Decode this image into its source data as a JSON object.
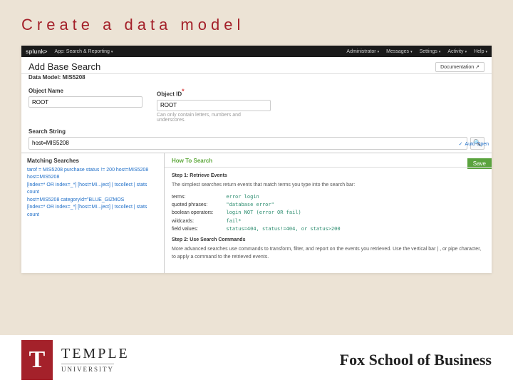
{
  "slide": {
    "title": "Create a data model"
  },
  "topbar": {
    "logo": "splunk>",
    "app_label": "App: Search & Reporting",
    "right": [
      "Administrator",
      "Messages",
      "Settings",
      "Activity",
      "Help"
    ]
  },
  "page": {
    "heading": "Add Base Search",
    "doc_link": "Documentation",
    "data_model_label": "Data Model:",
    "data_model_value": "MIS5208"
  },
  "fields": {
    "object_name_label": "Object Name",
    "object_name_value": "ROOT",
    "object_id_label": "Object ID",
    "object_id_value": "ROOT",
    "object_id_hint": "Can only contain letters, numbers and underscores."
  },
  "search": {
    "label": "Search String",
    "value": "host=MIS5208",
    "auto_open": "Auto Open",
    "save_label": "Save"
  },
  "matching": {
    "heading": "Matching Searches",
    "lines": [
      "tarof = MIS5208 purchase status != 200 host=MIS5208",
      "host=MIS5208",
      "[index=* OR index=_*] [host=MI...ject] | tscollect | stats count",
      "host=MIS5208 categoryId=\"BLUE_GIZMOS",
      "[index=* OR index=_*] [host=MI...ject] | tscollect | stats count"
    ]
  },
  "howto": {
    "heading": "How To Search",
    "step1_title": "Step 1: Retrieve Events",
    "step1_desc": "The simplest searches return events that match terms you type into the search bar:",
    "rows": [
      {
        "lbl": "terms:",
        "ex": "error login"
      },
      {
        "lbl": "quoted phrases:",
        "ex": "\"database error\""
      },
      {
        "lbl": "boolean operators:",
        "ex": "login NOT (error OR fail)"
      },
      {
        "lbl": "wildcards:",
        "ex": "fail*"
      },
      {
        "lbl": "field values:",
        "ex": "status=404, status!=404, or status>200"
      }
    ],
    "step2_title": "Step 2: Use Search Commands",
    "step2_desc": "More advanced searches use commands to transform, filter, and report on the events you retrieved. Use the vertical bar | , or pipe character, to apply a command to the retrieved events."
  },
  "footer": {
    "logo_letter": "T",
    "university": "TEMPLE",
    "sub": "UNIVERSITY",
    "school": "Fox School of Business"
  }
}
